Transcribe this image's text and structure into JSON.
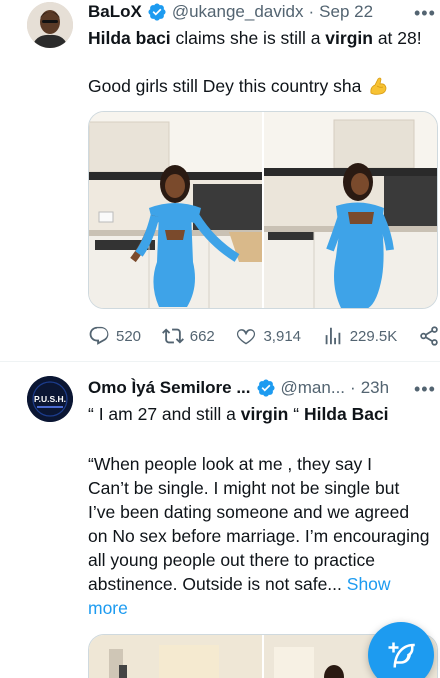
{
  "tweets": [
    {
      "author": {
        "name": "BaLoX",
        "handle": "@ukange_davidx",
        "verified": true
      },
      "separator": "·",
      "date": "Sep 22",
      "more_label": "•••",
      "text_parts": {
        "p1": "Hilda baci",
        "p2": " claims she is still a ",
        "p3": "virgin",
        "p4": " at 28!",
        "line2": "Good girls still Dey this country sha"
      },
      "emoji_icon": "flexed-biceps-icon",
      "media": [
        "photo-1",
        "photo-2"
      ],
      "actions": {
        "replies": "520",
        "reposts": "662",
        "likes": "3,914",
        "views": "229.5K"
      }
    },
    {
      "author": {
        "name": "Omo Ìyá Semilore ...",
        "handle": "@man...",
        "verified": true,
        "avatar_text": "P.U.S.H."
      },
      "separator": "·",
      "date": "23h",
      "more_label": "•••",
      "text_parts": {
        "quote_open": "“ I am 27 and still a ",
        "virgin": "virgin",
        "quote_close": " “ ",
        "name": "Hilda Baci",
        "body1": "“When people look at me , they say I",
        "body2": "Can’t be single. I might not be single but",
        "body3": "I’ve been dating someone and we agreed",
        "body4": "on No sex before marriage. I’m encouraging",
        "body5": "all young people out there to practice",
        "body6": "abstinence.  Outside is not safe... ",
        "show": "Show",
        "more": "more"
      }
    }
  ],
  "fab_icon": "compose-post-icon",
  "colors": {
    "accent": "#1d9bf0",
    "muted": "#536471",
    "text": "#0f1419",
    "dress": "#3ea3e8"
  }
}
